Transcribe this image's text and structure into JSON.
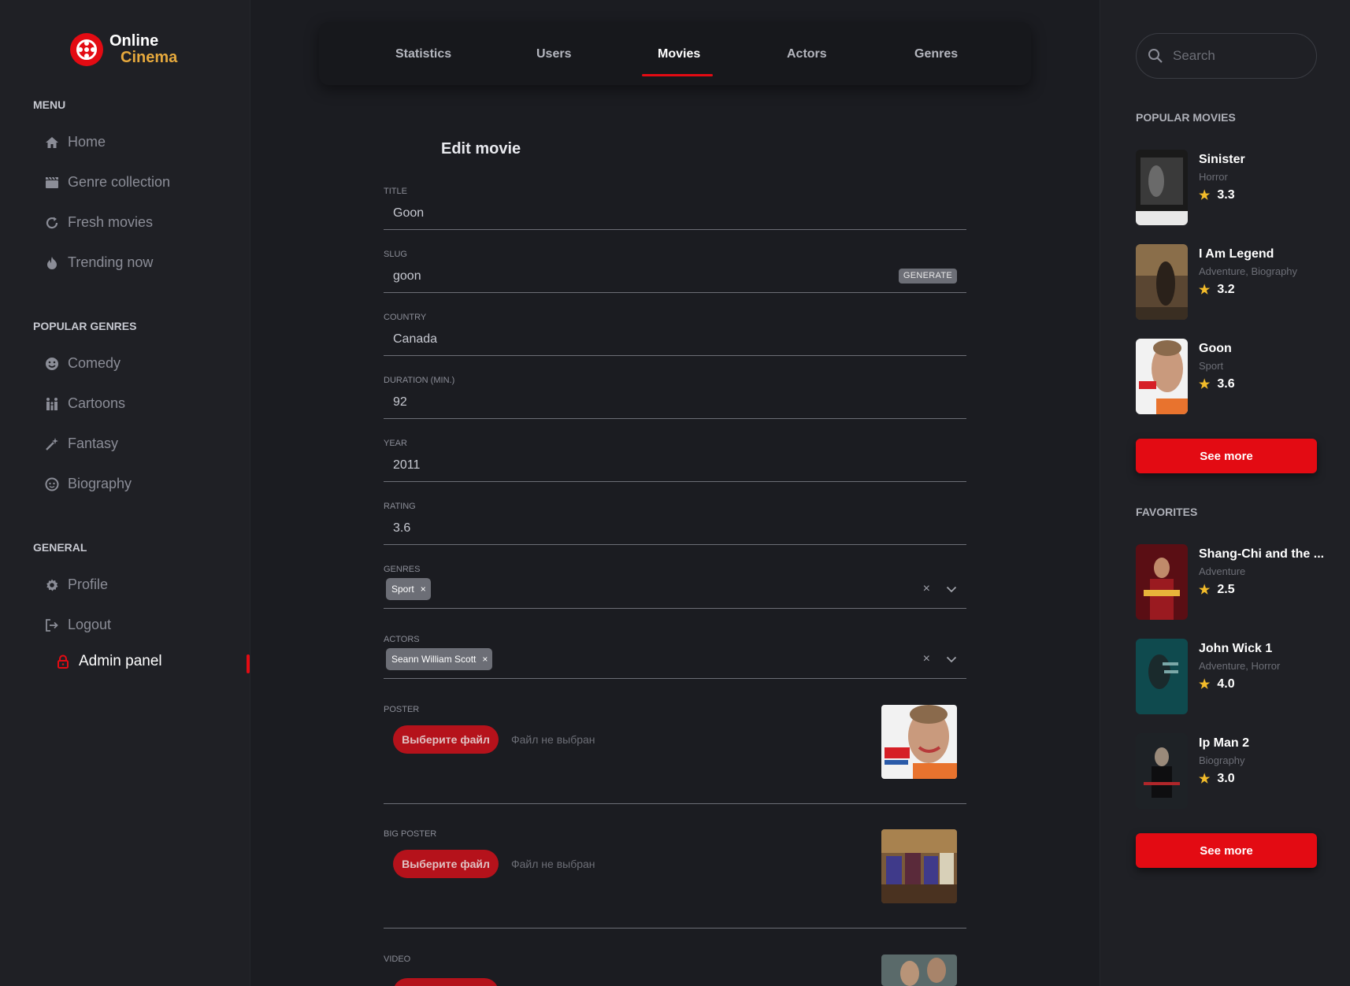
{
  "logo": {
    "line1": "Online",
    "line2": "Cinema"
  },
  "left_nav": {
    "menu_heading": "MENU",
    "menu_items": [
      {
        "label": "Home",
        "icon": "home-icon"
      },
      {
        "label": "Genre collection",
        "icon": "clapperboard-icon"
      },
      {
        "label": "Fresh movies",
        "icon": "refresh-icon"
      },
      {
        "label": "Trending now",
        "icon": "fire-icon"
      }
    ],
    "genres_heading": "POPULAR GENRES",
    "genre_items": [
      {
        "label": "Comedy",
        "icon": "smile-icon"
      },
      {
        "label": "Cartoons",
        "icon": "family-icon"
      },
      {
        "label": "Fantasy",
        "icon": "magic-wand-icon"
      },
      {
        "label": "Biography",
        "icon": "face-icon"
      }
    ],
    "general_heading": "GENERAL",
    "general_items": [
      {
        "label": "Profile",
        "icon": "gear-icon"
      },
      {
        "label": "Logout",
        "icon": "logout-icon"
      },
      {
        "label": "Admin panel",
        "icon": "lock-icon",
        "active": true
      }
    ]
  },
  "tabs": [
    {
      "label": "Statistics"
    },
    {
      "label": "Users"
    },
    {
      "label": "Movies",
      "active": true
    },
    {
      "label": "Actors"
    },
    {
      "label": "Genres"
    }
  ],
  "form": {
    "title": "Edit movie",
    "fields": {
      "title": {
        "label": "TITLE",
        "value": "Goon"
      },
      "slug": {
        "label": "SLUG",
        "value": "goon",
        "button": "GENERATE"
      },
      "country": {
        "label": "COUNTRY",
        "value": "Canada"
      },
      "duration": {
        "label": "DURATION (MIN.)",
        "value": "92"
      },
      "year": {
        "label": "YEAR",
        "value": "2011"
      },
      "rating": {
        "label": "RATING",
        "value": "3.6"
      },
      "genres": {
        "label": "GENRES",
        "selected": "Sport",
        "remove": "×"
      },
      "actors": {
        "label": "ACTORS",
        "selected": "Seann William Scott",
        "remove": "×"
      },
      "poster": {
        "label": "POSTER",
        "button": "Выберите файл",
        "note": "Файл не выбран"
      },
      "big_poster": {
        "label": "BIG POSTER",
        "button": "Выберите файл",
        "note": "Файл не выбран"
      },
      "video": {
        "label": "VIDEO"
      }
    },
    "select_clear": "×"
  },
  "right_panel": {
    "search_placeholder": "Search",
    "popular_heading": "POPULAR MOVIES",
    "popular": [
      {
        "title": "Sinister",
        "genres": "Horror",
        "rating": "3.3"
      },
      {
        "title": "I Am Legend",
        "genres": "Adventure, Biography",
        "rating": "3.2"
      },
      {
        "title": "Goon",
        "genres": "Sport",
        "rating": "3.6"
      }
    ],
    "see_more_1": "See more",
    "favorites_heading": "FAVORITES",
    "favorites": [
      {
        "title": "Shang-Chi and the ...",
        "genres": "Adventure",
        "rating": "2.5"
      },
      {
        "title": "John Wick 1",
        "genres": "Adventure, Horror",
        "rating": "4.0"
      },
      {
        "title": "Ip Man 2",
        "genres": "Biography",
        "rating": "3.0"
      }
    ],
    "see_more_2": "See more",
    "star": "★"
  },
  "colors": {
    "accent": "#e30b13",
    "logo_gold": "#e6a93d",
    "star": "#f3bc2a",
    "background": "#1b1c21",
    "sidebar": "#1f2025"
  }
}
